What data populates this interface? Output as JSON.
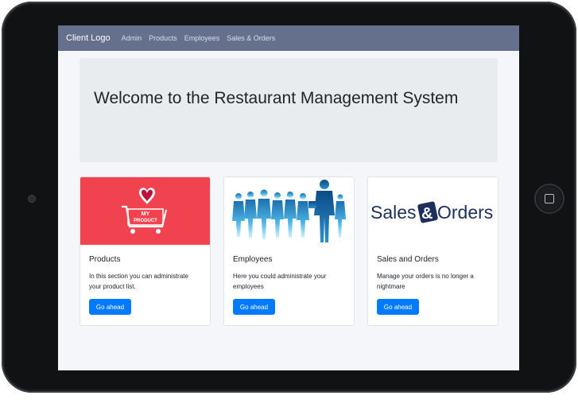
{
  "navbar": {
    "brand": "Client Logo",
    "links": [
      "Admin",
      "Products",
      "Employees",
      "Sales & Orders"
    ]
  },
  "jumbotron": {
    "title": "Welcome to the Restaurant Management System"
  },
  "cards": [
    {
      "title": "Products",
      "text": "In this section you can administrate your product list.",
      "button": "Go ahead",
      "image_logo_text": [
        "MY",
        "PRODUCT"
      ],
      "image_bg": "#f0434f"
    },
    {
      "title": "Employees",
      "text": "Here you could administrate your employees",
      "button": "Go ahead"
    },
    {
      "title": "Sales and Orders",
      "text": "Manage your orders is no longer a nightmare",
      "button": "Go ahead",
      "image_logo_text": [
        "Sales",
        "&",
        "Orders"
      ]
    }
  ],
  "colors": {
    "navbar": "#65708c",
    "button": "#007bff",
    "jumbotron": "#e9ecef",
    "page": "#f4f6fa"
  }
}
